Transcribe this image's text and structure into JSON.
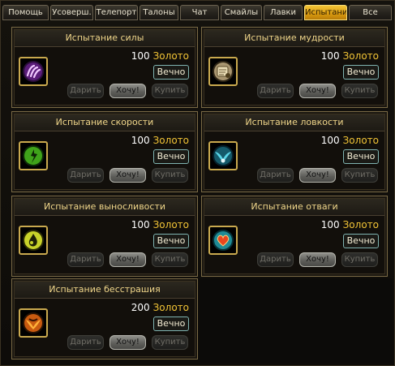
{
  "tabs": [
    "Помощь",
    "Усоверш.",
    "Телепорт",
    "Талоны",
    "Чат",
    "Смайлы",
    "Лавки",
    "Испытания",
    "Все"
  ],
  "active_tab": "Испытания",
  "colors": {
    "accent": "#f2c436",
    "title": "#f0d68a",
    "border": "#7a6a45"
  },
  "buttons": {
    "gift": "Дарить",
    "want": "Хочу!",
    "buy": "Купить"
  },
  "items": [
    {
      "title": "Испытание силы",
      "price": "100",
      "currency": "Золото",
      "duration": "Вечно",
      "icon": "strength-claw-icon"
    },
    {
      "title": "Испытание мудрости",
      "price": "100",
      "currency": "Золото",
      "duration": "Вечно",
      "icon": "wisdom-scroll-icon"
    },
    {
      "title": "Испытание скорости",
      "price": "100",
      "currency": "Золото",
      "duration": "Вечно",
      "icon": "speed-runner-icon"
    },
    {
      "title": "Испытание ловкости",
      "price": "100",
      "currency": "Золото",
      "duration": "Вечно",
      "icon": "agility-wings-icon"
    },
    {
      "title": "Испытание выносливости",
      "price": "100",
      "currency": "Золото",
      "duration": "Вечно",
      "icon": "stamina-drop-icon"
    },
    {
      "title": "Испытание отваги",
      "price": "100",
      "currency": "Золото",
      "duration": "Вечно",
      "icon": "courage-heart-icon"
    },
    {
      "title": "Испытание бесстрашия",
      "price": "200",
      "currency": "Золото",
      "duration": "Вечно",
      "icon": "fearless-bird-icon"
    }
  ]
}
